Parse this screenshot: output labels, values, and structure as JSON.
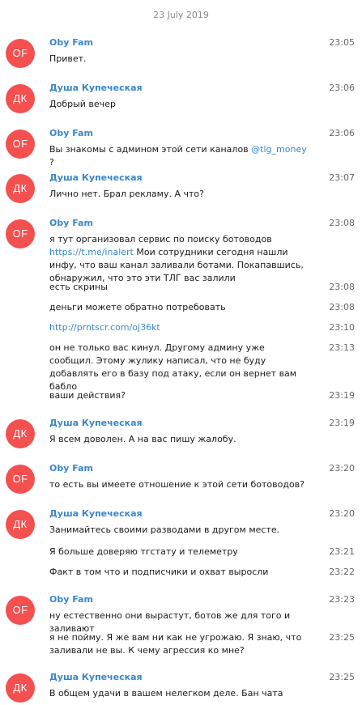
{
  "date_header": "23 July 2019",
  "colors": {
    "avatar_bg": "#f3504f",
    "name_color": "#3a87c8",
    "link_color": "#3a87c8"
  },
  "avatars": {
    "oby": "OF",
    "dusha": "ДК"
  },
  "names": {
    "oby": "Oby Fam",
    "dusha": "Душа Купеческая"
  },
  "messages": [
    {
      "time": "23:05",
      "text": "Привет."
    },
    {
      "time": "23:06",
      "text": "Добрый вечер"
    },
    {
      "time": "23:06",
      "text_before": "Вы знакомы с админом этой сети каналов ",
      "link": "@tlg_money",
      "text_after": " ?"
    },
    {
      "time": "23:07",
      "text": "Лично нет. Брал рекламу. А что?"
    },
    {
      "time": "23:08",
      "text_before": "я тут организовал сервис по поиску ботоводов ",
      "link": "https://t.me/inalert",
      "text_after": " Мои сотрудники сегодня нашли инфу, что ваш канал заливали ботами. Покапавшись, обнаружил, что это эти ТЛГ вас залили"
    },
    {
      "time": "23:08",
      "text": "есть скрины"
    },
    {
      "time": "23:08",
      "text": "деньги можете обратно потребовать"
    },
    {
      "time": "23:10",
      "link": "http://prntscr.com/oj36kt"
    },
    {
      "time": "23:13",
      "text": "он не только вас кинул. Другому админу уже сообщил. Этому жулику написал, что не буду добавлять его в базу под атаку, если он вернет вам бабло"
    },
    {
      "time": "23:19",
      "text": "ваши действия?"
    },
    {
      "time": "23:19",
      "text": "Я всем доволен. А на вас пишу жалобу."
    },
    {
      "time": "23:20",
      "text": "то есть вы имеете отношение к этой сети ботоводов?"
    },
    {
      "time": "23:20",
      "text": "Занимайтесь своими разводами в другом месте."
    },
    {
      "time": "23:21",
      "text": "Я больше доверяю тгстату и телеметру"
    },
    {
      "time": "23:22",
      "text": "Факт в том что и подписчики и охват выросли"
    },
    {
      "time": "23:23",
      "text": "ну естественно они вырастут, ботов же для того и заливают"
    },
    {
      "time": "23:25",
      "text": "я не пойму. Я же вам ни как не угрожаю. Я знаю, что заливали не вы. К чему агрессия ко мне?"
    },
    {
      "time": "23:25",
      "text": "В общем удачи в вашем нелегком деле. Бан чата"
    }
  ]
}
